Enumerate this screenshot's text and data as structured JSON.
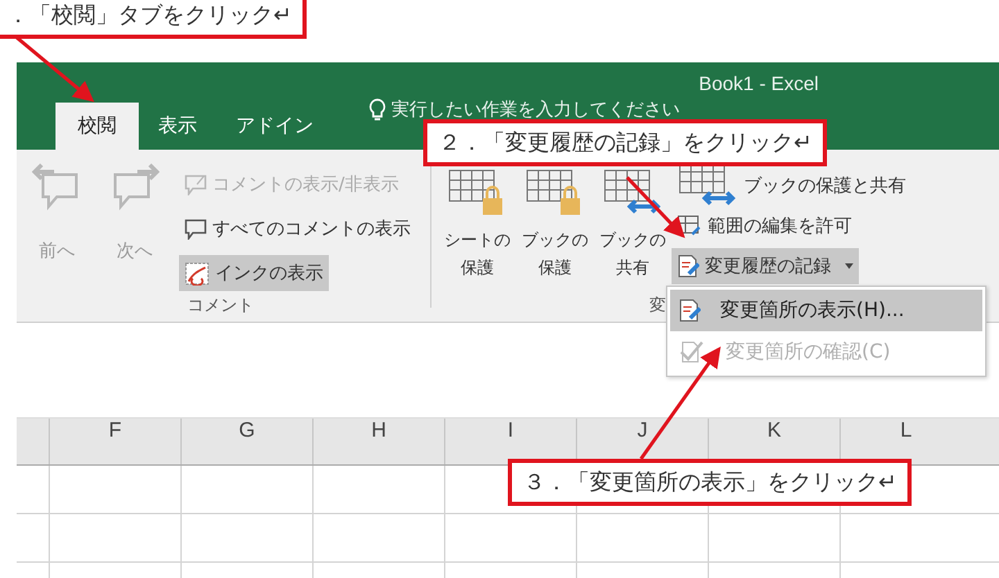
{
  "window": {
    "title": "Book1  -  Excel"
  },
  "tabs": [
    {
      "label": "校閲",
      "selected": true
    },
    {
      "label": "表示",
      "selected": false
    },
    {
      "label": "アドイン",
      "selected": false
    }
  ],
  "tell_me": {
    "placeholder": "実行したい作業を入力してください"
  },
  "ribbon_groups": [
    {
      "label": "コメント",
      "large_buttons": [
        {
          "label": "前へ",
          "kind": "prev",
          "disabled": true
        },
        {
          "label": "次へ",
          "kind": "next",
          "disabled": true
        }
      ],
      "small_buttons": [
        {
          "label": "コメントの表示/非表示",
          "kind": "comment",
          "disabled": true,
          "selected": false,
          "has_menu": false
        },
        {
          "label": "すべてのコメントの表示",
          "kind": "comments",
          "disabled": false,
          "selected": false,
          "has_menu": false
        },
        {
          "label": "インクの表示",
          "kind": "ink",
          "disabled": false,
          "selected": true,
          "has_menu": false
        }
      ]
    },
    {
      "label": "変",
      "large_buttons": [
        {
          "label": "シートの保護",
          "kind": "sheet_lock",
          "disabled": false
        },
        {
          "label": "ブックの保護",
          "kind": "book_lock",
          "disabled": false
        },
        {
          "label": "ブックの共有",
          "kind": "share",
          "disabled": false
        }
      ],
      "small_buttons": [
        {
          "label": "ブックの保護と共有",
          "kind": "share",
          "disabled": false,
          "selected": false,
          "has_menu": false
        },
        {
          "label": "範囲の編集を許可",
          "kind": "range",
          "disabled": false,
          "selected": false,
          "has_menu": false
        },
        {
          "label": "変更履歴の記録",
          "kind": "track",
          "disabled": false,
          "selected": true,
          "has_menu": true
        }
      ]
    }
  ],
  "dropdown_menu": [
    {
      "label": "変更箇所の表示(H)...",
      "kind": "track",
      "selected": true,
      "disabled": false
    },
    {
      "label": "変更箇所の確認(C)",
      "kind": "accept",
      "selected": false,
      "disabled": true
    }
  ],
  "columns": [
    "F",
    "G",
    "H",
    "I",
    "J",
    "K",
    "L"
  ],
  "callouts": [
    "．「校閲」タブをクリック↵",
    "２．「変更履歴の記録」をクリック↵",
    "３．「変更箇所の表示」をクリック↵"
  ]
}
